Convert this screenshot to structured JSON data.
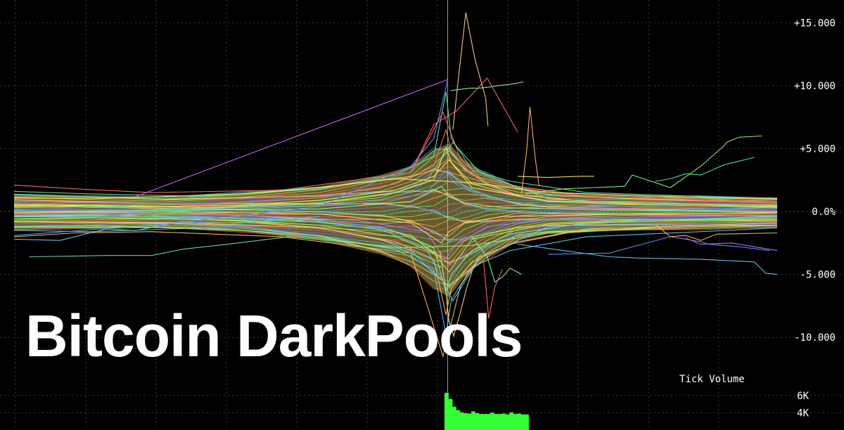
{
  "headline": "Bitcoin DarkPools",
  "colors": {
    "background": "#000000",
    "grid": "#3a3a3a",
    "text": "#ffffff",
    "volume": "#33ff33",
    "zero_line": "#555555",
    "spike_marker": "#9a9a9a",
    "series_palette": [
      "#ff6b6b",
      "#ffb86b",
      "#f5e663",
      "#9bf06b",
      "#5ee6a0",
      "#5ec8f0",
      "#6b8cff",
      "#c86bff",
      "#7dff9b",
      "#ffd27d"
    ]
  },
  "chart_data": [
    {
      "type": "line",
      "title": "",
      "xlabel": "",
      "ylabel": "",
      "y_unit": "%",
      "y_ticks": [
        {
          "value": 15,
          "label": "+15.000"
        },
        {
          "value": 10,
          "label": "+10.000"
        },
        {
          "value": 5,
          "label": "+5.000"
        },
        {
          "value": 0,
          "label": "0.0%"
        },
        {
          "value": -5,
          "label": "-5.000"
        },
        {
          "value": -10,
          "label": "-10.000"
        }
      ],
      "ylim": [
        -12.5,
        16.8
      ],
      "xlim": [
        0,
        100
      ],
      "grid": true,
      "legend": "none",
      "spike_x": 57,
      "series": [
        {
          "x": [
            0,
            10,
            25,
            40,
            50,
            55,
            56.6,
            57.3,
            60,
            65,
            75,
            90,
            100
          ],
          "values": [
            0.8,
            0.7,
            0.6,
            1.1,
            2.2,
            3.6,
            6.5,
            4.8,
            2.9,
            2.0,
            1.2,
            0.9,
            0.7
          ]
        },
        {
          "x": [
            0,
            10,
            25,
            40,
            50,
            55,
            56.6,
            57.3,
            60,
            65,
            75,
            90,
            100
          ],
          "values": [
            -0.8,
            -0.9,
            -1.0,
            -1.3,
            -2.4,
            -3.8,
            -8.2,
            -6.1,
            -4.0,
            -2.6,
            -1.4,
            -1.1,
            -0.9
          ]
        },
        {
          "x": [
            0,
            10,
            25,
            40,
            50,
            55,
            56.6,
            57.3,
            60,
            65,
            75,
            90,
            100
          ],
          "values": [
            0.4,
            0.5,
            0.3,
            0.7,
            1.5,
            2.5,
            5.1,
            3.9,
            2.2,
            1.4,
            0.8,
            0.6,
            0.5
          ]
        },
        {
          "x": [
            0,
            10,
            25,
            40,
            50,
            55,
            56.6,
            57.3,
            60,
            65,
            75,
            90,
            100
          ],
          "values": [
            -0.4,
            -0.3,
            -0.5,
            -0.8,
            -1.6,
            -2.9,
            -6.4,
            -5.0,
            -3.1,
            -1.8,
            -0.9,
            -0.7,
            -0.6
          ]
        },
        {
          "x": [
            0,
            10,
            25,
            40,
            50,
            55,
            56.6,
            57.3,
            60,
            65,
            75,
            90,
            100
          ],
          "values": [
            1.6,
            1.4,
            1.2,
            1.8,
            2.9,
            4.4,
            9.5,
            5.8,
            3.3,
            2.4,
            1.5,
            1.2,
            1.0
          ]
        },
        {
          "x": [
            0,
            10,
            25,
            40,
            50,
            55,
            56.6,
            57.3,
            60,
            65,
            75,
            90,
            100
          ],
          "values": [
            -1.5,
            -1.6,
            -1.3,
            -1.9,
            -3.0,
            -4.6,
            -9.8,
            -7.0,
            -4.4,
            -3.1,
            -2.0,
            -1.6,
            -1.3
          ]
        },
        {
          "x": [
            0,
            15,
            30,
            45,
            54,
            56.5,
            58,
            62,
            70,
            85,
            100
          ],
          "values": [
            0.2,
            0.1,
            0.3,
            0.6,
            1.4,
            3.2,
            2.1,
            1.0,
            0.5,
            0.3,
            0.2
          ]
        },
        {
          "x": [
            0,
            15,
            30,
            45,
            54,
            56.5,
            58,
            62,
            70,
            85,
            100
          ],
          "values": [
            -0.2,
            -0.1,
            -0.3,
            -0.7,
            -1.6,
            -3.8,
            -2.6,
            -1.2,
            -0.6,
            -0.4,
            -0.3
          ]
        },
        {
          "x": [
            0,
            20,
            40,
            52,
            56,
            57,
            59,
            64,
            80,
            100
          ],
          "values": [
            0.0,
            0.1,
            0.2,
            0.8,
            2.0,
            1.2,
            0.7,
            0.3,
            0.1,
            0.0
          ]
        },
        {
          "x": [
            0,
            20,
            40,
            52,
            56,
            57,
            59,
            64,
            80,
            100
          ],
          "values": [
            -0.1,
            0.0,
            -0.2,
            -0.9,
            -2.5,
            -1.6,
            -0.9,
            -0.4,
            -0.2,
            -0.1
          ]
        },
        {
          "x": [
            0,
            8,
            18,
            35,
            52,
            56.2,
            58.5,
            61,
            66,
            72,
            85,
            100
          ],
          "values": [
            2.1,
            1.8,
            1.5,
            1.7,
            3.1,
            7.9,
            4.2,
            2.7,
            2.0,
            1.5,
            1.1,
            0.8
          ]
        },
        {
          "x": [
            0,
            8,
            18,
            35,
            52,
            56.2,
            58.5,
            61,
            66,
            72,
            85,
            100
          ],
          "values": [
            -2.0,
            -1.7,
            -1.6,
            -2.0,
            -3.3,
            -11.5,
            -5.9,
            -3.6,
            -2.4,
            -1.7,
            -1.2,
            -0.9
          ]
        },
        {
          "x": [
            0,
            10,
            20,
            30,
            40,
            50,
            55,
            57,
            60,
            70,
            80,
            90,
            100
          ],
          "values": [
            0.6,
            0.5,
            0.4,
            0.5,
            0.9,
            1.7,
            2.8,
            4.1,
            1.9,
            0.8,
            0.6,
            0.5,
            0.4
          ]
        },
        {
          "x": [
            0,
            10,
            20,
            30,
            40,
            50,
            55,
            57,
            60,
            70,
            80,
            90,
            100
          ],
          "values": [
            -0.6,
            -0.5,
            -0.6,
            -0.7,
            -1.1,
            -2.0,
            -3.3,
            -4.8,
            -2.2,
            -1.0,
            -0.7,
            -0.6,
            -0.5
          ]
        },
        {
          "x": [
            2,
            12,
            18,
            22,
            28,
            36,
            50,
            56
          ],
          "values": [
            -3.6,
            -3.5,
            -3.5,
            -3.0,
            -2.6,
            -2.0,
            -2.8,
            -4.4
          ]
        },
        {
          "x": [
            0,
            6,
            12,
            16,
            22,
            28,
            40
          ],
          "values": [
            -2.2,
            -2.3,
            -1.4,
            -1.5,
            -0.8,
            -1.0,
            -0.4
          ]
        },
        {
          "x": [
            0,
            20,
            40,
            52,
            55,
            56.8
          ],
          "values": [
            -1.9,
            -1.0,
            0.4,
            3.6,
            5.8,
            10.4
          ]
        },
        {
          "x": [
            16,
            56.9
          ],
          "values": [
            1.2,
            10.5
          ]
        },
        {
          "x": [
            57.2,
            58.5,
            59.8,
            61,
            62.5,
            63.5,
            65,
            66.8
          ],
          "values": [
            9.6,
            9.7,
            9.8,
            9.8,
            9.9,
            10.0,
            10.1,
            10.3
          ]
        },
        {
          "x": [
            57.5,
            58.3,
            59.2,
            60.4,
            61.8,
            62.1
          ],
          "values": [
            6.5,
            11.0,
            15.8,
            12.1,
            9.0,
            6.8
          ]
        },
        {
          "x": [
            52,
            55,
            58,
            62,
            66
          ],
          "values": [
            3.1,
            6.9,
            8.0,
            10.6,
            6.3
          ]
        },
        {
          "x": [
            66.5,
            67.2,
            67.6,
            68.0,
            68.3,
            68.8
          ],
          "values": [
            1.4,
            5.0,
            8.3,
            6.0,
            4.2,
            2.0
          ]
        },
        {
          "x": [
            66,
            70,
            74,
            76
          ],
          "values": [
            2.8,
            2.7,
            2.8,
            2.8
          ]
        },
        {
          "x": [
            67,
            72,
            76,
            80,
            81,
            86,
            90,
            93,
            93.4,
            95,
            98
          ],
          "values": [
            1.4,
            1.8,
            1.9,
            2.0,
            2.9,
            1.9,
            3.6,
            5.2,
            5.5,
            5.9,
            6.0
          ]
        },
        {
          "x": [
            84,
            86,
            88,
            90,
            93,
            97
          ],
          "values": [
            2.4,
            2.6,
            3.0,
            2.9,
            3.7,
            4.3
          ]
        },
        {
          "x": [
            66,
            72,
            78,
            82,
            90,
            97,
            98.5,
            100
          ],
          "values": [
            -2.6,
            -3.1,
            -3.6,
            -3.7,
            -3.8,
            -4.0,
            -4.9,
            -5.0
          ]
        },
        {
          "x": [
            70,
            78,
            86,
            90,
            91,
            95,
            99
          ],
          "values": [
            -3.4,
            -3.3,
            -2.0,
            -2.4,
            -2.6,
            -2.8,
            -3.1
          ]
        },
        {
          "x": [
            88,
            90,
            94,
            100
          ],
          "values": [
            -2.1,
            -2.6,
            -2.5,
            -3.1
          ]
        },
        {
          "x": [
            60,
            62,
            63,
            64,
            65,
            66.5
          ],
          "values": [
            -2.0,
            -3.6,
            -5.6,
            -5.2,
            -4.5,
            -5.0
          ]
        },
        {
          "x": [
            55.8,
            56.5,
            57.0,
            57.6,
            58.4,
            59.3,
            60.3
          ],
          "values": [
            -3.2,
            -5.9,
            -8.7,
            -9.9,
            -8.2,
            -6.1,
            -4.2
          ]
        },
        {
          "x": [
            61.5,
            62.2,
            63.0,
            64.0
          ],
          "values": [
            -3.8,
            -8.5,
            -6.0,
            -4.6
          ]
        },
        {
          "x": [
            84,
            86,
            88,
            90,
            92,
            100
          ],
          "values": [
            -1.0,
            -2.0,
            -1.9,
            -2.3,
            -1.8,
            -1.7
          ]
        },
        {
          "x": [
            0,
            10,
            20,
            30,
            40,
            50,
            60,
            70,
            80,
            90,
            100
          ],
          "values": [
            1.1,
            1.0,
            1.2,
            1.4,
            1.9,
            2.6,
            2.3,
            1.5,
            1.3,
            1.1,
            1.0
          ]
        },
        {
          "x": [
            0,
            10,
            20,
            30,
            40,
            50,
            60,
            70,
            80,
            90,
            100
          ],
          "values": [
            -1.2,
            -1.1,
            -1.3,
            -1.5,
            -2.1,
            -2.9,
            -2.7,
            -1.7,
            -1.4,
            -1.2,
            -1.1
          ]
        },
        {
          "x": [
            0,
            12,
            24,
            36,
            48,
            54,
            57.5,
            61,
            70,
            82,
            100
          ],
          "values": [
            0.3,
            0.4,
            0.2,
            0.5,
            1.1,
            2.4,
            5.5,
            3.1,
            1.0,
            0.6,
            0.3
          ]
        },
        {
          "x": [
            0,
            12,
            24,
            36,
            48,
            54,
            57.5,
            61,
            70,
            82,
            100
          ],
          "values": [
            -0.3,
            -0.2,
            -0.4,
            -0.6,
            -1.4,
            -2.9,
            -7.1,
            -3.7,
            -1.2,
            -0.7,
            -0.4
          ]
        }
      ],
      "band": {
        "x": [
          0,
          10,
          20,
          30,
          40,
          48,
          52,
          55,
          57,
          59,
          62,
          66,
          70,
          80,
          90,
          100
        ],
        "upper": [
          1.4,
          1.3,
          1.2,
          1.5,
          2.0,
          2.9,
          3.6,
          4.9,
          5.4,
          4.1,
          3.0,
          1.9,
          1.5,
          1.3,
          1.2,
          1.1
        ],
        "lower": [
          -1.5,
          -1.4,
          -1.3,
          -1.6,
          -2.3,
          -3.4,
          -4.3,
          -6.1,
          -6.8,
          -5.2,
          -3.7,
          -2.3,
          -1.8,
          -1.5,
          -1.4,
          -1.3
        ]
      }
    },
    {
      "type": "bar",
      "title": "Tick Volume",
      "y_ticks": [
        {
          "value": 6000,
          "label": "6K"
        },
        {
          "value": 4000,
          "label": "4K"
        }
      ],
      "ylim": [
        2000,
        7200
      ],
      "x": [
        56.4,
        56.9,
        57.4,
        57.9,
        58.4,
        58.9,
        59.4,
        59.9,
        60.4,
        60.9,
        61.4,
        61.9,
        62.4,
        62.9,
        63.4,
        63.9,
        64.4,
        64.9,
        65.4,
        65.9,
        66.4,
        66.9
      ],
      "values": [
        6300,
        5600,
        4700,
        4300,
        4050,
        3950,
        3900,
        4150,
        3950,
        3850,
        3850,
        3850,
        4000,
        3850,
        3850,
        3900,
        3800,
        4050,
        3850,
        3900,
        3800,
        3800
      ]
    }
  ]
}
